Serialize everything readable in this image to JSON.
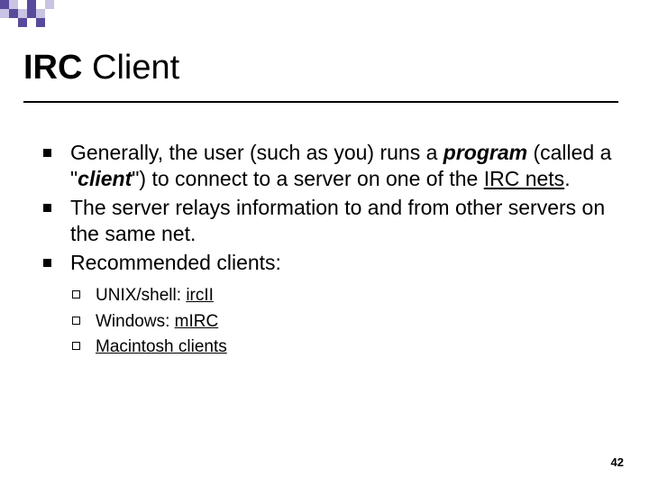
{
  "title": {
    "bold": "IRC",
    "rest": " Client"
  },
  "bullets": {
    "b1": {
      "pre": "Generally, the user (such as you) runs a ",
      "program": "program",
      "mid1": " (called a \"",
      "client": "client",
      "mid2": "\") to connect to a server on one of the ",
      "ircnets": "IRC nets",
      "post": "."
    },
    "b2": "The server relays information to and from other servers on the same net.",
    "b3": "Recommended clients:"
  },
  "subs": {
    "s1": {
      "label": "UNIX/shell: ",
      "link": "ircII"
    },
    "s2": {
      "label": "Windows: ",
      "link": "mIRC"
    },
    "s3": {
      "link": "Macintosh clients"
    }
  },
  "page_number": "42"
}
